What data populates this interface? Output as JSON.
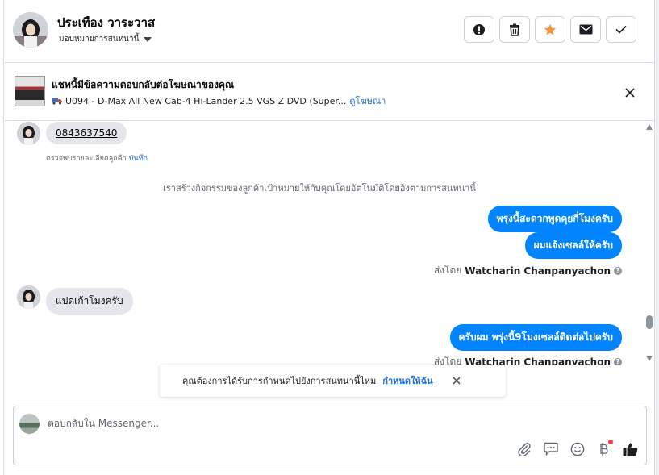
{
  "header": {
    "contact_name": "ประเทือง วาระวาส",
    "assign_label": "มอบหมายการสนทนานี้",
    "buttons": [
      {
        "icon": "alert-circle-icon"
      },
      {
        "icon": "trash-icon"
      },
      {
        "icon": "star-icon",
        "color": "#f7923b"
      },
      {
        "icon": "envelope-icon"
      },
      {
        "icon": "check-icon"
      }
    ]
  },
  "ad_banner": {
    "title": "แชทนี้มีข้อความตอบกลับต่อโฆษณาของคุณ",
    "product": "U094 - D-Max All New Cab-4 Hi-Lander 2.5 VGS Z DVD (Super...",
    "view_ad_link": "ดูโฆษณา"
  },
  "messages": {
    "phone": "0843637540",
    "detail_note": "ตรวจพบรายละเอียดลูกค้า",
    "save_link": "บันทึก",
    "system_note": "เราสร้างกิจกรรมของลูกค้าเป้าหมายให้กับคุณโดยอัตโนมัติโดยอิงตามการสนทนานี้",
    "out_1": "พรุ่งนี้สะดวกพูดคุยกี่โมงครับ",
    "out_2": "ผมแจ้งเซลล์ให้ครับ",
    "sent_by_label": "ส่งโดย",
    "sender_name": "Watcharin Chanpanyachon",
    "in_2": "แปดเก้าโมงครับ",
    "out_3": "ครับผม พรุ่งนี้9โมงเซลล์ติดต่อไปครับ",
    "sent_by_label_2": "ส่งโดย",
    "sender_name_2": "Watcharin Chanpanyachon"
  },
  "reminder": {
    "text": "คุณต้องการได้รับการกำหนดไปยังการสนทนานี้ไหม",
    "link": "กำหนดให้ฉัน"
  },
  "composer": {
    "placeholder": "ตอบกลับใน Messenger..."
  },
  "colors": {
    "accent": "#0084ff",
    "link": "#216fdb",
    "star": "#f7923b"
  }
}
